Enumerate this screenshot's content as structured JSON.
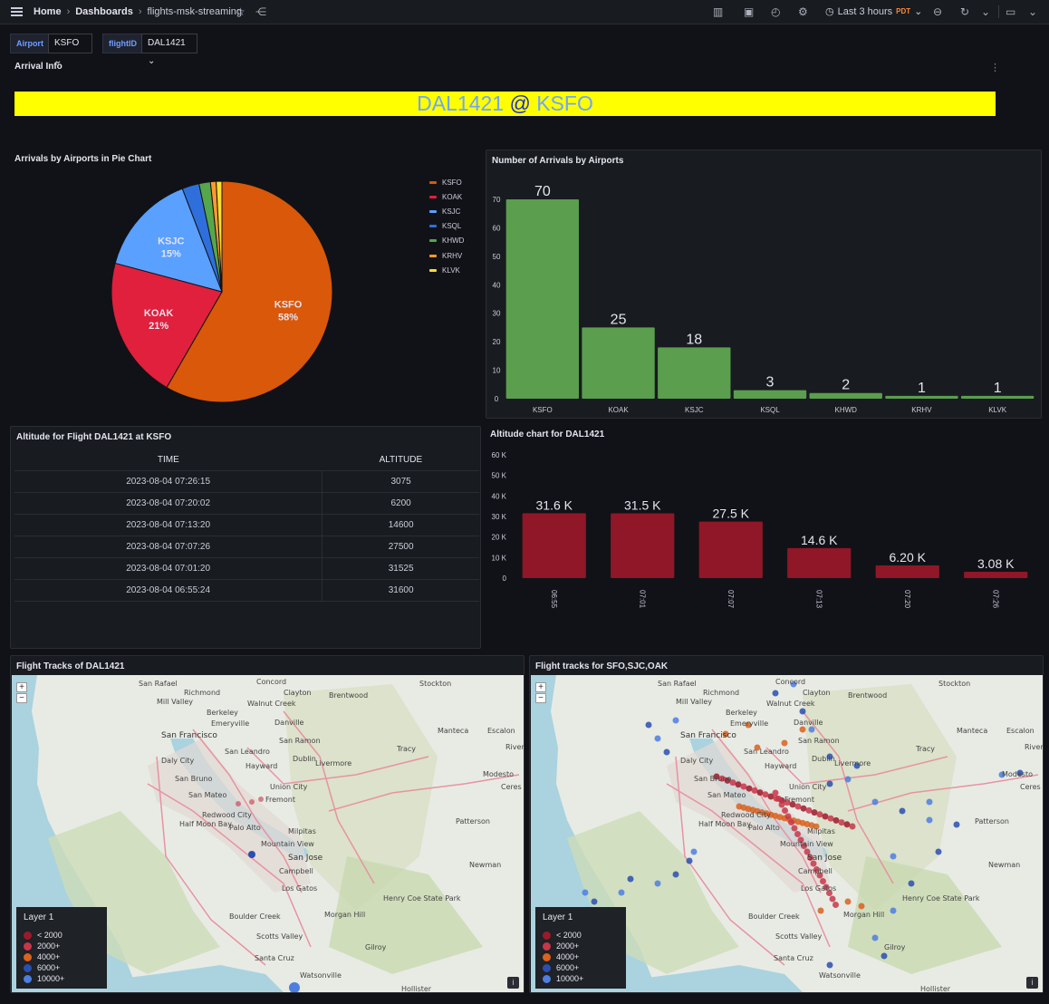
{
  "nav": {
    "home": "Home",
    "dashboards": "Dashboards",
    "current": "flights-msk-streaming",
    "time_range": "Last 3 hours",
    "timezone": "PDT"
  },
  "variables": [
    {
      "label": "Airport",
      "value": "KSFO"
    },
    {
      "label": "flightID",
      "value": "DAL1421"
    }
  ],
  "row_title": "Arrival Info",
  "banner": {
    "flight": "DAL1421",
    "at": "@",
    "airport": "KSFO"
  },
  "pie_panel": {
    "title": "Arrivals by Airports in Pie Chart"
  },
  "bar_panel": {
    "title": "Number of Arrivals by Airports"
  },
  "table_panel": {
    "title": "Altitude for Flight DAL1421 at KSFO",
    "columns": [
      "TIME",
      "ALTITUDE"
    ],
    "rows": [
      [
        "2023-08-04 07:26:15",
        "3075"
      ],
      [
        "2023-08-04 07:20:02",
        "6200"
      ],
      [
        "2023-08-04 07:13:20",
        "14600"
      ],
      [
        "2023-08-04 07:07:26",
        "27500"
      ],
      [
        "2023-08-04 07:01:20",
        "31525"
      ],
      [
        "2023-08-04 06:55:24",
        "31600"
      ]
    ]
  },
  "alt_chart_panel": {
    "title": "Altitude chart for DAL1421"
  },
  "map_panels": [
    {
      "title": "Flight Tracks of DAL1421"
    },
    {
      "title": "Flight tracks for SFO,SJC,OAK"
    }
  ],
  "map_legend": {
    "title": "Layer 1",
    "items": [
      {
        "label": "< 2000",
        "color": "#9b1a2a"
      },
      {
        "label": "2000+",
        "color": "#c8364a"
      },
      {
        "label": "4000+",
        "color": "#d9621e"
      },
      {
        "label": "6000+",
        "color": "#2a4fb0"
      },
      {
        "label": "10000+",
        "color": "#4d7ee0"
      }
    ]
  },
  "map_places": [
    "San Rafael",
    "Concord",
    "Richmond",
    "Clayton",
    "Brentwood",
    "Stockton",
    "Mill Valley",
    "Walnut Creek",
    "Berkeley",
    "Emeryville",
    "Danville",
    "San Francisco",
    "San Leandro",
    "San Ramon",
    "Manteca",
    "Escalon",
    "Riverbank",
    "Tracy",
    "Daly City",
    "Dublin",
    "Livermore",
    "Hayward",
    "San Bruno",
    "Modesto",
    "Union City",
    "Ceres",
    "San Mateo",
    "Fremont",
    "Redwood City",
    "Half Moon Bay",
    "Patterson",
    "Palo Alto",
    "Milpitas",
    "Mountain View",
    "San Jose",
    "Campbell",
    "Newman",
    "Los Gatos",
    "Henry Coe State Park",
    "Boulder Creek",
    "Morgan Hill",
    "Scotts Valley",
    "Gilroy",
    "Santa Cruz",
    "Watsonville",
    "Hollister"
  ],
  "chart_data": [
    {
      "type": "pie",
      "title": "Arrivals by Airports in Pie Chart",
      "categories": [
        "KSFO",
        "KOAK",
        "KSJC",
        "KSQL",
        "KHWD",
        "KRHV",
        "KLVK"
      ],
      "values": [
        70,
        25,
        18,
        3,
        2,
        1,
        1
      ],
      "slice_labels": [
        {
          "name": "KSFO",
          "percent": "58%"
        },
        {
          "name": "KOAK",
          "percent": "21%"
        },
        {
          "name": "KSJC",
          "percent": "15%"
        }
      ],
      "colors": [
        "#d9580a",
        "#e0203c",
        "#5aa0ff",
        "#2f6fdc",
        "#56a64b",
        "#ff9830",
        "#fade2a"
      ],
      "legend_position": "right"
    },
    {
      "type": "bar",
      "title": "Number of Arrivals by Airports",
      "categories": [
        "KSFO",
        "KOAK",
        "KSJC",
        "KSQL",
        "KHWD",
        "KRHV",
        "KLVK"
      ],
      "values": [
        70,
        25,
        18,
        3,
        2,
        1,
        1
      ],
      "value_labels": [
        "70",
        "25",
        "18",
        "3",
        "2",
        "1",
        "1"
      ],
      "ylim": [
        0,
        70
      ],
      "yticks": [
        "0",
        "10",
        "20",
        "30",
        "40",
        "50",
        "60",
        "70"
      ],
      "color": "#5a9e4e"
    },
    {
      "type": "bar",
      "title": "Altitude chart for DAL1421",
      "categories": [
        "06:55",
        "07:01",
        "07:07",
        "07:13",
        "07:20",
        "07:26"
      ],
      "values": [
        31600,
        31525,
        27500,
        14600,
        6200,
        3075
      ],
      "value_labels": [
        "31.6 K",
        "31.5 K",
        "27.5 K",
        "14.6 K",
        "6.20 K",
        "3.08 K"
      ],
      "ylim": [
        0,
        60000
      ],
      "yticks": [
        "0",
        "10 K",
        "20 K",
        "30 K",
        "40 K",
        "50 K",
        "60 K"
      ],
      "color": "#8f1727"
    }
  ]
}
